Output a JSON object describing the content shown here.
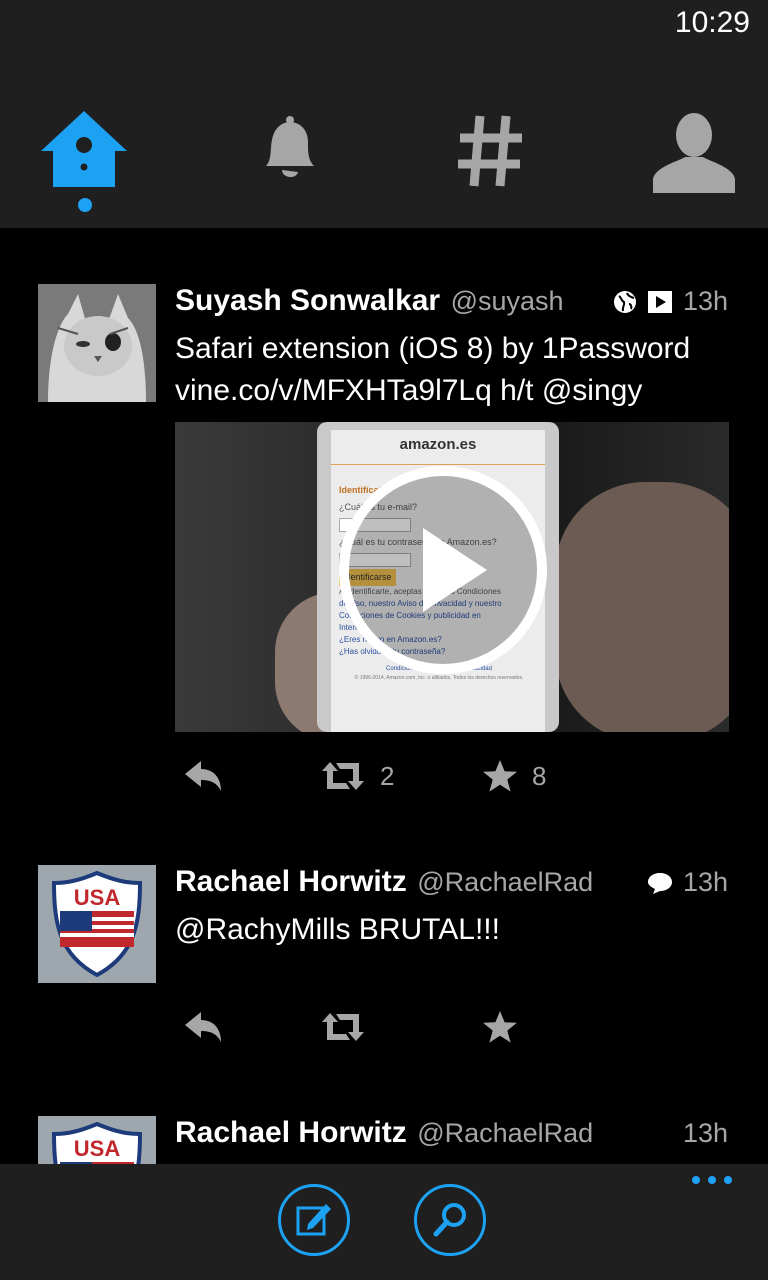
{
  "status_bar": {
    "time": "10:29"
  },
  "nav": {
    "tabs": [
      {
        "id": "home",
        "icon": "birdhouse-home-icon",
        "active": true
      },
      {
        "id": "notifications",
        "icon": "bell-icon",
        "active": false
      },
      {
        "id": "discover",
        "icon": "hashtag-icon",
        "active": false
      },
      {
        "id": "profile",
        "icon": "person-icon",
        "active": false
      }
    ],
    "accent_color": "#1da1f2",
    "inactive_color": "#a6a6a6"
  },
  "tweets": [
    {
      "name": "Suyash Sonwalkar",
      "handle": "@suyash",
      "time": "13h",
      "text_line1": "Safari extension (iOS 8) by 1Password",
      "text_line2": "vine.co/v/MFXHTa9l7Lq h/t @singy",
      "meta_icons": [
        "globe-icon",
        "video-icon"
      ],
      "media": {
        "type": "video",
        "site_label": "amazon.es",
        "screen_lines": [
          "Identifícate",
          "¿Cuál es tu e-mail?",
          "¿Cuál es tu contraseña de Amazon.es?",
          "Identificarse",
          "Al identificarte, aceptas nuestras Condiciones",
          "de Uso, nuestro Aviso de privacidad y nuestro",
          "Condiciones de Cookies y publicidad en",
          "Internet.",
          "¿Eres nuevo en Amazon.es?",
          "¿Has olvidado tu contraseña?",
          "Condiciones de uso   Aviso de privacidad",
          "© 1996-2014, Amazon.com, Inc. o afiliados. Todos los derechos reservados."
        ]
      },
      "retweets": "2",
      "favorites": "8"
    },
    {
      "name": "Rachael Horwitz",
      "handle": "@RachaelRad",
      "time": "13h",
      "text_line1": "@RachyMills BRUTAL!!!",
      "meta_icons": [
        "conversation-icon"
      ],
      "avatar_text": "USA"
    },
    {
      "name": "Rachael Horwitz",
      "handle": "@RachaelRad",
      "time": "13h",
      "avatar_text": "USA"
    }
  ]
}
